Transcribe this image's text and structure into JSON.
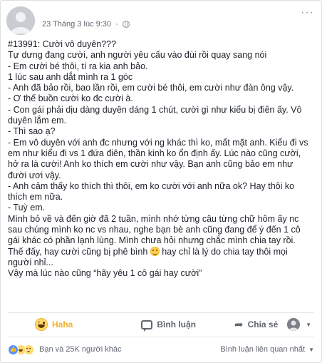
{
  "post": {
    "author_name": "",
    "timestamp": "23 Tháng 3 lúc 9:30",
    "privacy_separator": "·",
    "more_label": "···",
    "lines": [
      "#13991: Cười vô duyên???",
      "Tự dưng đang cười, anh người yêu cấu vào đùi rồi quay sang nói",
      "- Em cười bé thôi, tí ra kia anh bảo.",
      "1 lúc sau anh dắt mình ra 1 góc",
      "- Anh đã bảo rồi, bao lần rồi, em cười bé thôi, em cười như đàn ông vậy.",
      "- Ơ thế buồn cười ko đc cười à.",
      "- Con gái phải dịu dàng duyên dáng 1 chút, cười gì như kiểu bị điên ấy. Vô",
      "duyên lắm em.",
      "- Thì sao ạ?",
      "- Em vô duyên với anh đc nhưng với ng khác thì ko, mất mặt anh. Kiểu đi vs",
      "em như kiểu đi vs 1 đứa điên, thần kinh ko ổn định ấy. Lúc nào cũng cười,",
      "hở ra là cười! Anh ko thích em cười như vậy. Bạn anh cũng bảo em như",
      "đười ươi vậy.",
      "- Anh cảm thấy ko thích thì thôi, em ko cười với anh nữa ok? Hay thôi ko",
      "thích em nữa.",
      "- Tuỳ em.",
      "Mình bỏ về và đến giờ đã 2 tuần, mình nhớ từng câu từng chữ hôm ấy nc",
      "sau chúng mình ko nc vs nhau, nghe bạn bè anh cũng đang để ý đến 1 cô",
      "gái khác có phần lạnh lùng. Mình chưa hỏi nhưng chắc mình chia tay rồi."
    ],
    "line_with_emoji_before": "Thế đấy, hay cười cũng bị phê bình",
    "line_with_emoji_after": " hay chỉ là lý do chia tay thôi mọi",
    "lines_tail": [
      "người nhỉ...",
      "Vậy mà lúc nào cũng “hãy yêu 1 cô gái hay cười”"
    ]
  },
  "actions": {
    "react_label": "Haha",
    "comment_label": "Bình luận",
    "share_label": "Chia sẻ",
    "caret": "▼"
  },
  "footer": {
    "reactors_text": "Bạn và 25K người khác",
    "sort_label": "Bình luận liên quan nhất",
    "sort_caret": "▼"
  },
  "colors": {
    "link_blue": "#365899",
    "haha_yellow": "#f7b125",
    "like_blue": "#5890ff",
    "meta_gray": "#616770"
  },
  "icons": {
    "react": "haha-icon",
    "comment": "comment-icon",
    "share": "share-icon",
    "privacy": "globe-icon"
  }
}
